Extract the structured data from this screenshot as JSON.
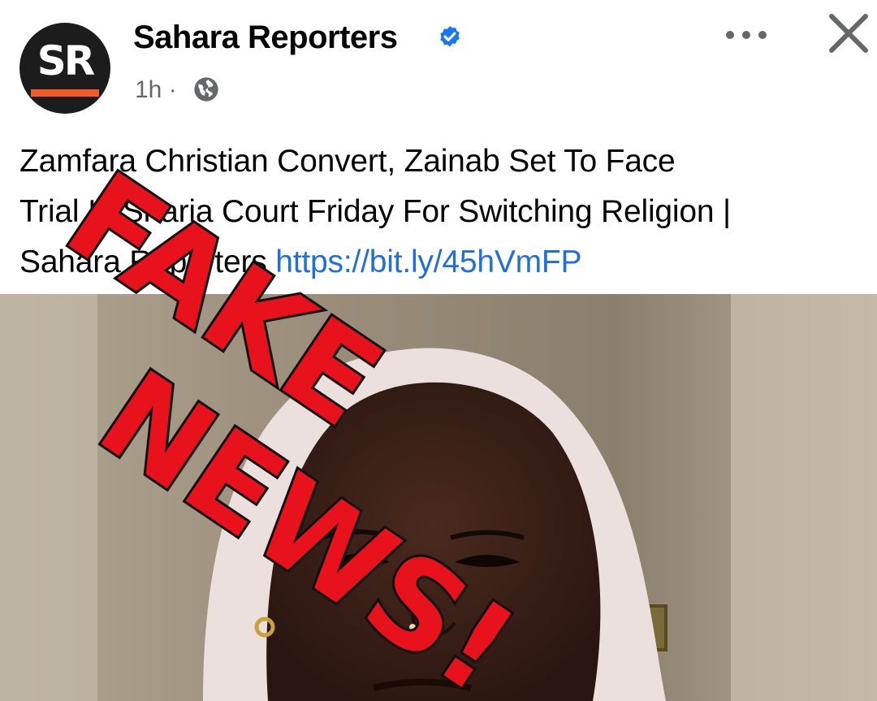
{
  "post": {
    "page_name": "Sahara Reporters",
    "avatar_text": "SR",
    "time": "1h",
    "separator": "·",
    "text_lines": [
      "Zamfara Christian Convert, Zainab Set To Face",
      "Trial In Sharia Court Friday For Switching Religion |",
      "Sahara Reporters "
    ],
    "link": "https://bit.ly/45hVmFP"
  },
  "overlay": {
    "line1": "FAKE",
    "line2": "NEWS!"
  },
  "colors": {
    "brand_orange": "#f15a29",
    "verified_blue": "#1877f2",
    "link_blue": "#216fdb",
    "stamp_red": "#e8121d"
  },
  "icons": {
    "verified": "verified-badge-icon",
    "audience": "globe-icon",
    "more": "more-options-icon",
    "close": "close-icon"
  }
}
